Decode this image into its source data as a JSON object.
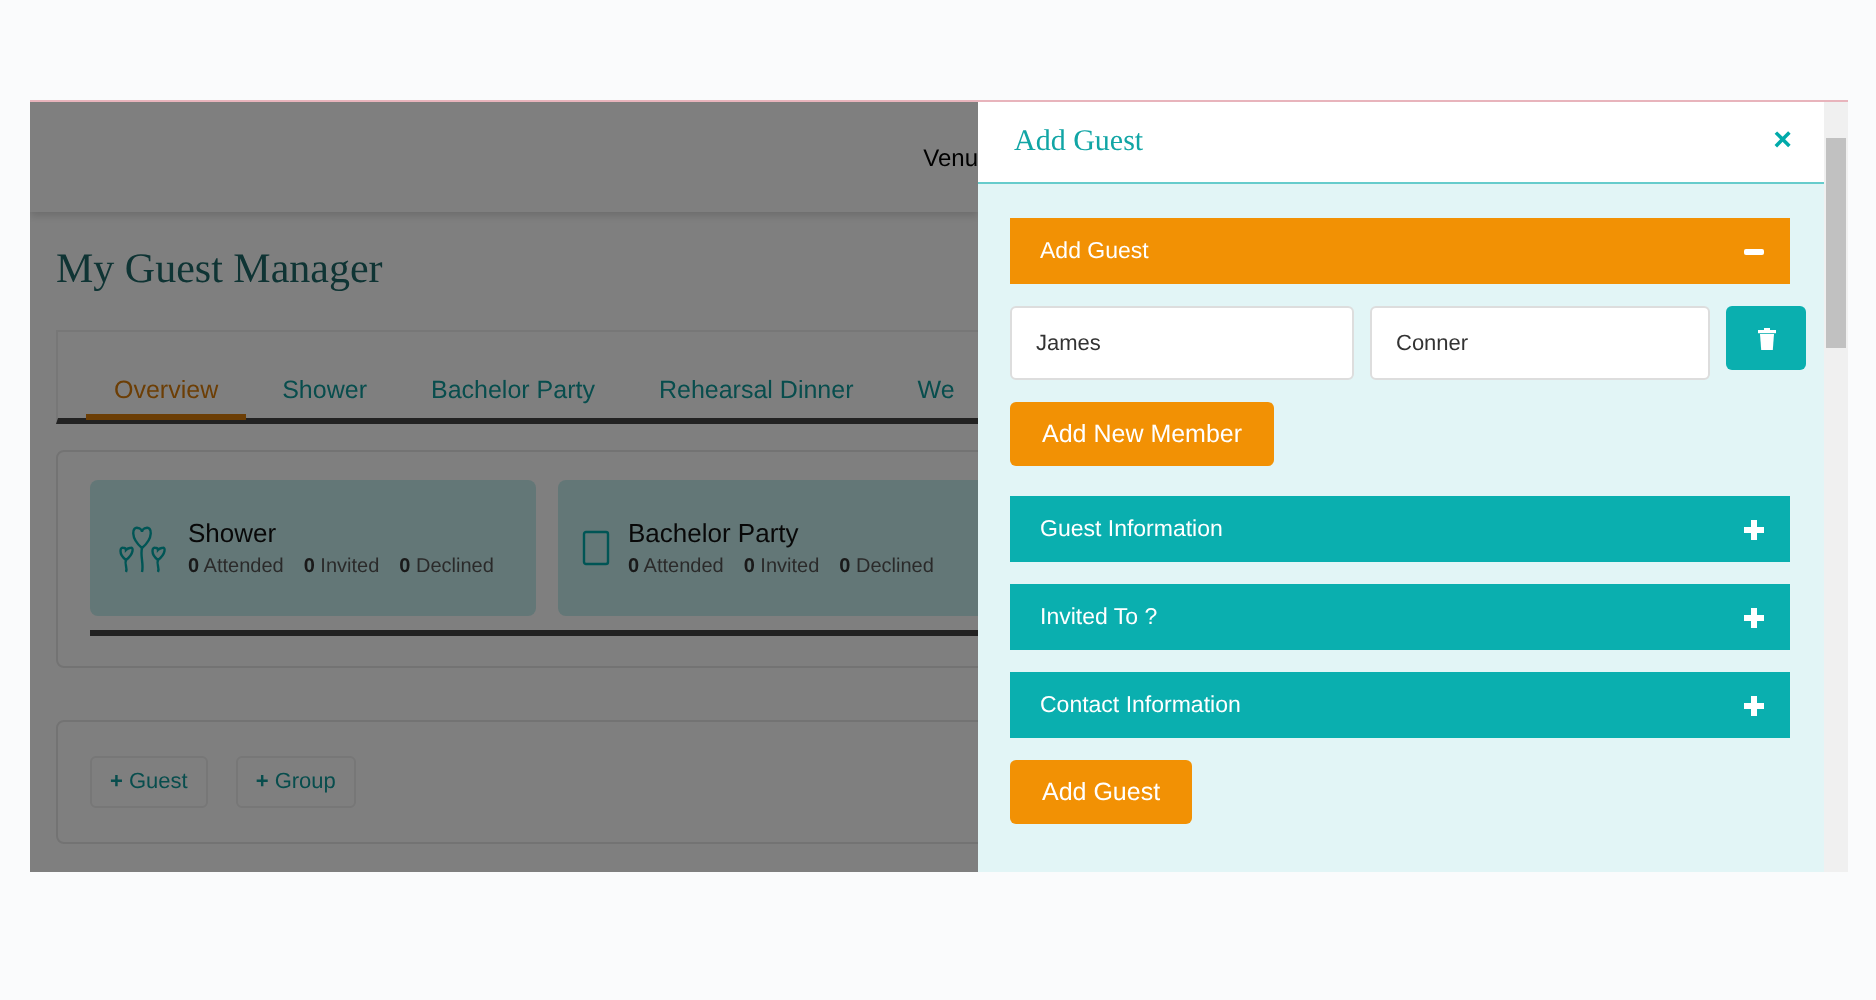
{
  "header": {
    "nav_text": "Venu"
  },
  "page_title": "My Guest Manager",
  "tabs": [
    {
      "label": "Overview",
      "selected": true
    },
    {
      "label": "Shower",
      "selected": false
    },
    {
      "label": "Bachelor Party",
      "selected": false
    },
    {
      "label": "Rehearsal Dinner",
      "selected": false
    },
    {
      "label": "We",
      "selected": false
    }
  ],
  "event_cards": [
    {
      "title": "Shower",
      "kind": "balloons",
      "stats": [
        {
          "count": "0",
          "label": "Attended"
        },
        {
          "count": "0",
          "label": "Invited"
        },
        {
          "count": "0",
          "label": "Declined"
        }
      ]
    },
    {
      "title": "Bachelor Party",
      "kind": "square",
      "stats": [
        {
          "count": "0",
          "label": "Attended"
        },
        {
          "count": "0",
          "label": "Invited"
        },
        {
          "count": "0",
          "label": "Declined"
        }
      ]
    }
  ],
  "actions": [
    {
      "icon": "+",
      "label": "Guest"
    },
    {
      "icon": "+",
      "label": "Group"
    }
  ],
  "panel": {
    "title": "Add Guest",
    "close": "×",
    "sections": [
      {
        "label": "Add Guest",
        "expanded": true
      },
      {
        "label": "Guest Information",
        "expanded": false
      },
      {
        "label": "Invited To ?",
        "expanded": false
      },
      {
        "label": "Contact Information",
        "expanded": false
      }
    ],
    "first_name": "James",
    "last_name": "Conner",
    "add_member_button": "Add New Member",
    "submit_button": "Add Guest"
  }
}
